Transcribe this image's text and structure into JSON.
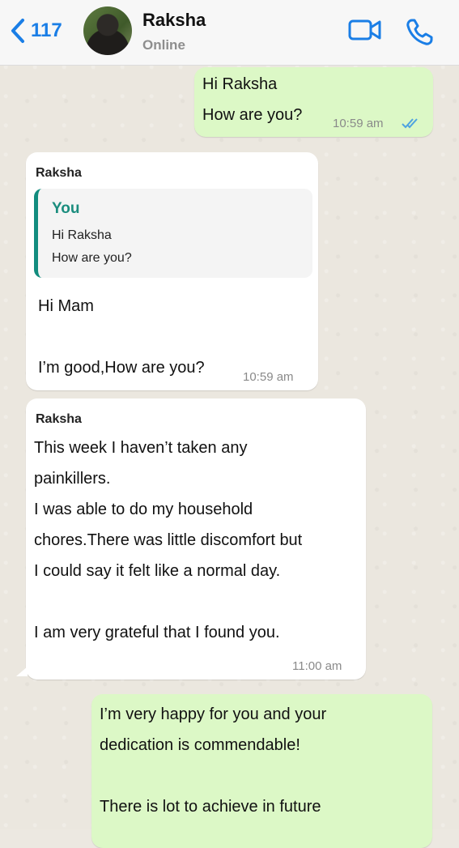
{
  "header": {
    "back_count": "117",
    "contact_name": "Raksha",
    "status": "Online"
  },
  "messages": [
    {
      "direction": "out",
      "lines": "Hi Raksha\nHow are you?",
      "time": "10:59 am",
      "read": true
    },
    {
      "direction": "in",
      "sender": "Raksha",
      "quote": {
        "author": "You",
        "text": "Hi Raksha\nHow are you?"
      },
      "lines": "Hi Mam\n\nI’m good,How are you?",
      "time": "10:59 am"
    },
    {
      "direction": "in",
      "sender": "Raksha",
      "lines": " This week I haven’t taken any\npainkillers.\nI was able to do my household\nchores.There was little discomfort but\nI could say it felt like a normal day.\n\nI am very grateful that I found you.",
      "time": "11:00 am"
    },
    {
      "direction": "out",
      "lines": " I’m very happy for you and your\ndedication is commendable!\n\nThere is lot to achieve in future"
    }
  ],
  "colors": {
    "accent": "#1a7ee6",
    "outgoing_bubble": "#dcf8c6",
    "incoming_bubble": "#ffffff",
    "quote_accent": "#128c7e",
    "read_ticks": "#4fa3e0"
  },
  "icons": {
    "back": "chevron-left-icon",
    "video": "video-camera-icon",
    "call": "phone-icon",
    "read": "double-check-icon"
  }
}
